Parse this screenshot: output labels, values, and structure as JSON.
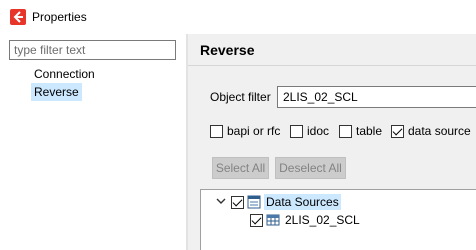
{
  "window": {
    "title": "Properties"
  },
  "left_panel": {
    "filter_placeholder": "type filter text",
    "items": [
      {
        "label": "Connection",
        "selected": false
      },
      {
        "label": "Reverse",
        "selected": true
      }
    ]
  },
  "page": {
    "title": "Reverse",
    "object_filter_label": "Object filter",
    "object_filter_value": "2LIS_02_SCL",
    "checkboxes": [
      {
        "label": "bapi or rfc",
        "checked": false
      },
      {
        "label": "idoc",
        "checked": false
      },
      {
        "label": "table",
        "checked": false
      },
      {
        "label": "data source",
        "checked": true
      }
    ],
    "buttons": {
      "select_all": "Select All",
      "deselect_all": "Deselect All"
    },
    "tree": {
      "root": {
        "label": "Data Sources",
        "checked": true,
        "expanded": true,
        "icon": "data-sources-icon"
      },
      "children": [
        {
          "label": "2LIS_02_SCL",
          "checked": true,
          "icon": "table-icon"
        }
      ]
    }
  },
  "colors": {
    "selection": "#cce8ff",
    "panel_bg": "#f0f0f0",
    "app_icon_red": "#e8352a"
  }
}
